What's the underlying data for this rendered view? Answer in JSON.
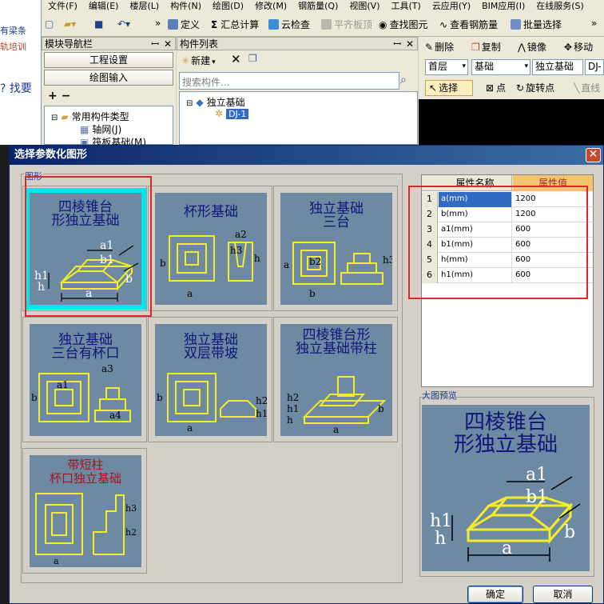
{
  "app": {
    "menu": [
      "文件(F)",
      "编辑(E)",
      "楼层(L)",
      "构件(N)",
      "绘图(D)",
      "修改(M)",
      "钢筋量(Q)",
      "视图(V)",
      "工具(T)",
      "云应用(Y)",
      "BIM应用(I)",
      "在线服务(S)"
    ],
    "left_strip": {
      "top_text": "有梁条",
      "sub_text": "轨培训",
      "question": "? 找要"
    },
    "toolbar1": {
      "define": "定义",
      "sum_calc": "汇总计算",
      "cloud_check": "云检查",
      "flat_slab": "平齐板顶",
      "find_element": "查找图元",
      "view_rebar": "查看钢筋量",
      "batch_select": "批量选择"
    },
    "module_nav": {
      "title": "模块导航栏",
      "btn_project": "工程设置",
      "btn_draw": "绘图输入",
      "tree": [
        {
          "label": "常用构件类型"
        },
        {
          "label": "轴网(J)"
        },
        {
          "label": "筏板基础(M)"
        }
      ]
    },
    "component_list": {
      "title": "构件列表",
      "new_label": "新建",
      "search_placeholder": "搜索构件...",
      "tree_parent": "独立基础",
      "tree_child": "DJ-1"
    },
    "right_toolbar": {
      "delete": "删除",
      "copy": "复制",
      "mirror": "镜像",
      "move": "移动",
      "floor": "首层",
      "category": "基础",
      "type": "独立基础",
      "item": "DJ-",
      "select": "选择",
      "point": "点",
      "rotate_point": "旋转点",
      "line": "直线"
    }
  },
  "dialog": {
    "title": "选择参数化图形",
    "close_glyph": "✕",
    "shapes_label": "图形",
    "shapes": [
      {
        "title": "四棱锥台\n形独立基础",
        "selected": true
      },
      {
        "title": "杯形基础",
        "selected": false
      },
      {
        "title": "独立基础\n三台",
        "selected": false
      },
      {
        "title": "独立基础\n三台有杯口",
        "selected": false
      },
      {
        "title": "独立基础\n双层带坡",
        "selected": false
      },
      {
        "title": "四棱锥台形\n独立基础带柱",
        "selected": false
      },
      {
        "title": "带短柱\n杯口独立基础",
        "selected": false
      }
    ],
    "prop_table": {
      "header_name": "属性名称",
      "header_value": "属性值",
      "rows": [
        {
          "num": "1",
          "name": "a(mm)",
          "value": "1200"
        },
        {
          "num": "2",
          "name": "b(mm)",
          "value": "1200"
        },
        {
          "num": "3",
          "name": "a1(mm)",
          "value": "600"
        },
        {
          "num": "4",
          "name": "b1(mm)",
          "value": "600"
        },
        {
          "num": "5",
          "name": "h(mm)",
          "value": "600"
        },
        {
          "num": "6",
          "name": "h1(mm)",
          "value": "600"
        }
      ]
    },
    "preview_label": "大图预览",
    "preview_title": "四棱锥台\n形独立基础",
    "ok": "确定",
    "cancel": "取消",
    "dim_labels": {
      "a": "a",
      "b": "b",
      "a1": "a1",
      "b1": "b1",
      "h": "h",
      "h1": "h1"
    }
  }
}
